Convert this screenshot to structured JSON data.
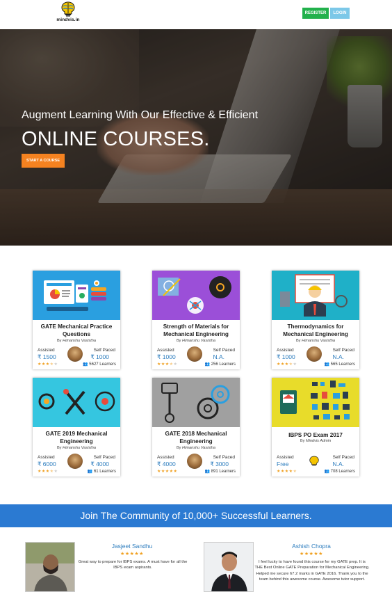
{
  "header": {
    "logo_text": "mindvis.in",
    "register_label": "REGISTER",
    "login_label": "LOGIN"
  },
  "hero": {
    "subtitle": "Augment Learning With Our Effective & Efficient",
    "title": "ONLINE COURSES.",
    "cta_label": "START A COURSE"
  },
  "courses": [
    {
      "title": "GATE Mechanical Practice Questions",
      "by_prefix": "By",
      "author": "Himanshu Vasistha",
      "assisted_label": "Assisted",
      "assisted_price": "₹ 1500",
      "self_label": "Self Paced",
      "self_price": "₹ 1000",
      "rating": 3.5,
      "learners": "5627 Learners"
    },
    {
      "title": "Strength of Materials for Mechanical Engineering",
      "by_prefix": "By",
      "author": "Himanshu Vasistha",
      "assisted_label": "Assisted",
      "assisted_price": "₹ 1000",
      "self_label": "Self Paced",
      "self_price": "N.A.",
      "rating": 3.5,
      "learners": "256 Learners"
    },
    {
      "title": "Thermodynamics for Mechanical Engineering",
      "by_prefix": "By",
      "author": "Himanshu Vasistha",
      "assisted_label": "Assisted",
      "assisted_price": "₹ 1000",
      "self_label": "Self Paced",
      "self_price": "N.A.",
      "rating": 3.5,
      "learners": "565 Learners"
    },
    {
      "title": "GATE 2019 Mechanical Engineering",
      "by_prefix": "By",
      "author": "Himanshu Vasistha",
      "assisted_label": "Assisted",
      "assisted_price": "₹ 6000",
      "self_label": "Self Paced",
      "self_price": "₹ 4000",
      "rating": 3.5,
      "learners": "61 Learners"
    },
    {
      "title": "GATE 2018 Mechanical Engineering",
      "by_prefix": "By",
      "author": "Himanshu Vasistha",
      "assisted_label": "Assisted",
      "assisted_price": "₹ 4000",
      "self_label": "Self Paced",
      "self_price": "₹ 3000",
      "rating": 5,
      "learners": "891 Learners"
    },
    {
      "title": "IBPS PO Exam 2017",
      "by_prefix": "By",
      "author": "Mindvis Admin",
      "assisted_label": "Assisted",
      "assisted_price": "Free",
      "self_label": "Self Paced",
      "self_price": "N.A.",
      "rating": 4.5,
      "learners": "708 Learners"
    }
  ],
  "community": {
    "text": "Join The Community of 10,000+ Successful Learners."
  },
  "testimonials": [
    {
      "name": "Jasjeet Sandhu",
      "rating": 5,
      "text": "Great way to prepare for IBPS exams. A must have for all the IBPS exam aspirants."
    },
    {
      "name": "Ashish Chopra",
      "rating": 5,
      "text": "I feel lucky to have found this course for my GATE prep. It is THE Best Online GATE Preparation for Mechanical Engineering. Helped me secure 67.2 marks in GATE 2016. Thank you to the team behind this awesome course. Awesome tutor support."
    }
  ],
  "colors": {
    "register": "#22b14c",
    "login": "#7cc8e8",
    "cta": "#f58220",
    "community": "#2b7ad2",
    "price": "#2a7bbd",
    "star": "#f0a020"
  }
}
